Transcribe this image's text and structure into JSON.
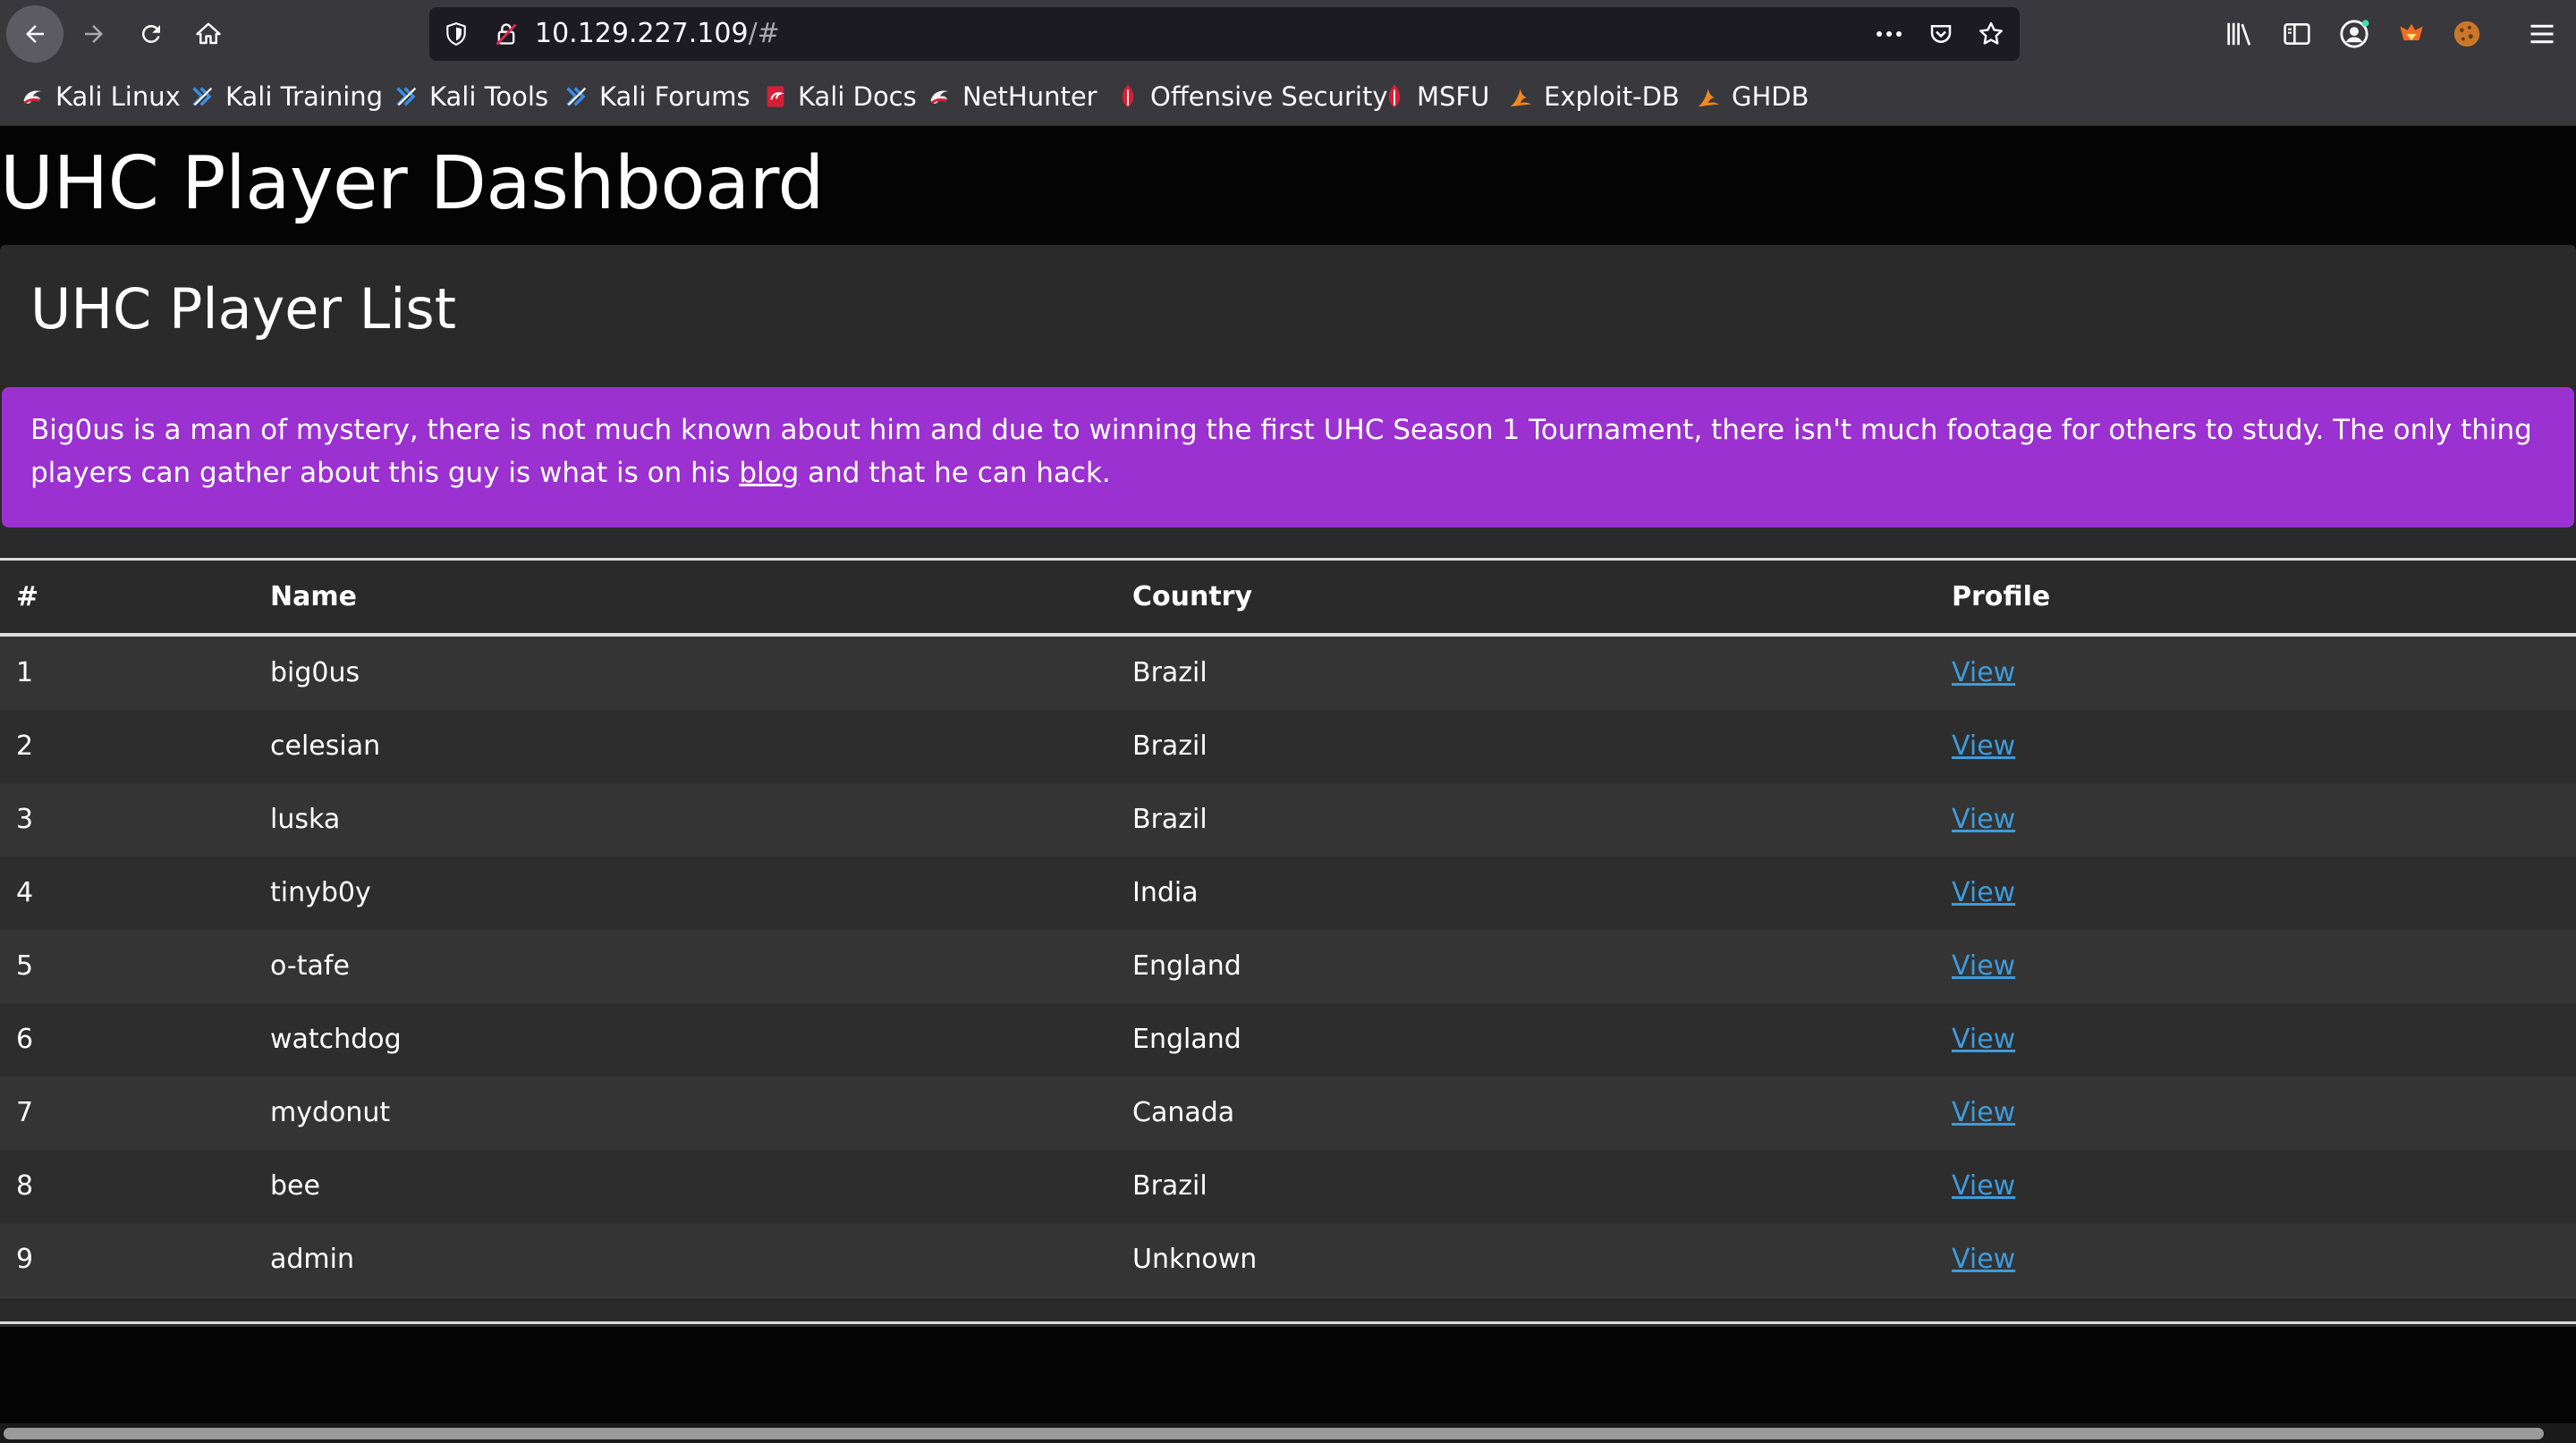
{
  "browser": {
    "url_main": "10.129.227.109",
    "url_rest": "/#",
    "bookmarks": [
      {
        "label": "Kali Linux",
        "icon": "kali-dragon-icon"
      },
      {
        "label": "Kali Training",
        "icon": "kali-training-icon"
      },
      {
        "label": "Kali Tools",
        "icon": "kali-tools-icon"
      },
      {
        "label": "Kali Forums",
        "icon": "kali-forums-icon"
      },
      {
        "label": "Kali Docs",
        "icon": "kali-docs-icon"
      },
      {
        "label": "NetHunter",
        "icon": "nethunter-icon"
      },
      {
        "label": "Offensive Security",
        "icon": "offsec-icon"
      },
      {
        "label": "MSFU",
        "icon": "msfu-icon"
      },
      {
        "label": "Exploit-DB",
        "icon": "exploit-db-icon"
      },
      {
        "label": "GHDB",
        "icon": "ghdb-icon"
      }
    ]
  },
  "page": {
    "title": "UHC Player Dashboard",
    "panel_title": "UHC Player List",
    "alert": {
      "text_before": "Big0us is a man of mystery, there is not much known about him and due to winning the first UHC Season 1 Tournament, there isn't much footage for others to study. The only thing players can gather about this guy is what is on his ",
      "link": "blog",
      "text_after": " and that he can hack."
    }
  },
  "table": {
    "headers": [
      "#",
      "Name",
      "Country",
      "Profile"
    ],
    "rows": [
      {
        "num": "1",
        "name": "big0us",
        "country": "Brazil",
        "profile": "View"
      },
      {
        "num": "2",
        "name": "celesian",
        "country": "Brazil",
        "profile": "View"
      },
      {
        "num": "3",
        "name": "luska",
        "country": "Brazil",
        "profile": "View"
      },
      {
        "num": "4",
        "name": "tinyb0y",
        "country": "India",
        "profile": "View"
      },
      {
        "num": "5",
        "name": "o-tafe",
        "country": "England",
        "profile": "View"
      },
      {
        "num": "6",
        "name": "watchdog",
        "country": "England",
        "profile": "View"
      },
      {
        "num": "7",
        "name": "mydonut",
        "country": "Canada",
        "profile": "View"
      },
      {
        "num": "8",
        "name": "bee",
        "country": "Brazil",
        "profile": "View"
      },
      {
        "num": "9",
        "name": "admin",
        "country": "Unknown",
        "profile": "View"
      }
    ]
  },
  "colors": {
    "alert_bg": "#9b31d0",
    "link": "#3e9bdc",
    "panel_bg": "#2a2a2a",
    "page_bg": "#040404"
  }
}
